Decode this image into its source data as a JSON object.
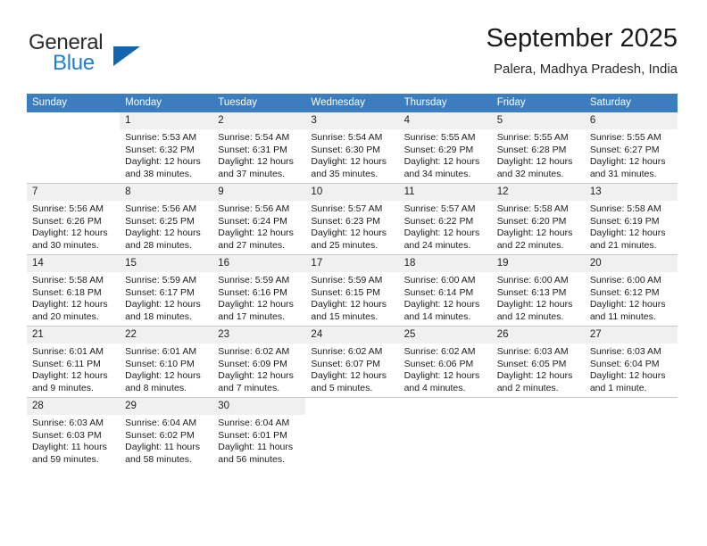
{
  "brand": {
    "word1": "General",
    "word2": "Blue",
    "triangle_color": "#1166ad",
    "blue_color": "#1f7fd0"
  },
  "header": {
    "title": "September 2025",
    "location": "Palera, Madhya Pradesh, India"
  },
  "calendar": {
    "header_bg": "#3b7dbf",
    "daynum_bg": "#f0f0f0",
    "weekdays": [
      "Sunday",
      "Monday",
      "Tuesday",
      "Wednesday",
      "Thursday",
      "Friday",
      "Saturday"
    ],
    "weeks": [
      [
        {
          "day": "",
          "blank": true,
          "lines": []
        },
        {
          "day": "1",
          "lines": [
            "Sunrise: 5:53 AM",
            "Sunset: 6:32 PM",
            "Daylight: 12 hours",
            "and 38 minutes."
          ]
        },
        {
          "day": "2",
          "lines": [
            "Sunrise: 5:54 AM",
            "Sunset: 6:31 PM",
            "Daylight: 12 hours",
            "and 37 minutes."
          ]
        },
        {
          "day": "3",
          "lines": [
            "Sunrise: 5:54 AM",
            "Sunset: 6:30 PM",
            "Daylight: 12 hours",
            "and 35 minutes."
          ]
        },
        {
          "day": "4",
          "lines": [
            "Sunrise: 5:55 AM",
            "Sunset: 6:29 PM",
            "Daylight: 12 hours",
            "and 34 minutes."
          ]
        },
        {
          "day": "5",
          "lines": [
            "Sunrise: 5:55 AM",
            "Sunset: 6:28 PM",
            "Daylight: 12 hours",
            "and 32 minutes."
          ]
        },
        {
          "day": "6",
          "lines": [
            "Sunrise: 5:55 AM",
            "Sunset: 6:27 PM",
            "Daylight: 12 hours",
            "and 31 minutes."
          ]
        }
      ],
      [
        {
          "day": "7",
          "lines": [
            "Sunrise: 5:56 AM",
            "Sunset: 6:26 PM",
            "Daylight: 12 hours",
            "and 30 minutes."
          ]
        },
        {
          "day": "8",
          "lines": [
            "Sunrise: 5:56 AM",
            "Sunset: 6:25 PM",
            "Daylight: 12 hours",
            "and 28 minutes."
          ]
        },
        {
          "day": "9",
          "lines": [
            "Sunrise: 5:56 AM",
            "Sunset: 6:24 PM",
            "Daylight: 12 hours",
            "and 27 minutes."
          ]
        },
        {
          "day": "10",
          "lines": [
            "Sunrise: 5:57 AM",
            "Sunset: 6:23 PM",
            "Daylight: 12 hours",
            "and 25 minutes."
          ]
        },
        {
          "day": "11",
          "lines": [
            "Sunrise: 5:57 AM",
            "Sunset: 6:22 PM",
            "Daylight: 12 hours",
            "and 24 minutes."
          ]
        },
        {
          "day": "12",
          "lines": [
            "Sunrise: 5:58 AM",
            "Sunset: 6:20 PM",
            "Daylight: 12 hours",
            "and 22 minutes."
          ]
        },
        {
          "day": "13",
          "lines": [
            "Sunrise: 5:58 AM",
            "Sunset: 6:19 PM",
            "Daylight: 12 hours",
            "and 21 minutes."
          ]
        }
      ],
      [
        {
          "day": "14",
          "lines": [
            "Sunrise: 5:58 AM",
            "Sunset: 6:18 PM",
            "Daylight: 12 hours",
            "and 20 minutes."
          ]
        },
        {
          "day": "15",
          "lines": [
            "Sunrise: 5:59 AM",
            "Sunset: 6:17 PM",
            "Daylight: 12 hours",
            "and 18 minutes."
          ]
        },
        {
          "day": "16",
          "lines": [
            "Sunrise: 5:59 AM",
            "Sunset: 6:16 PM",
            "Daylight: 12 hours",
            "and 17 minutes."
          ]
        },
        {
          "day": "17",
          "lines": [
            "Sunrise: 5:59 AM",
            "Sunset: 6:15 PM",
            "Daylight: 12 hours",
            "and 15 minutes."
          ]
        },
        {
          "day": "18",
          "lines": [
            "Sunrise: 6:00 AM",
            "Sunset: 6:14 PM",
            "Daylight: 12 hours",
            "and 14 minutes."
          ]
        },
        {
          "day": "19",
          "lines": [
            "Sunrise: 6:00 AM",
            "Sunset: 6:13 PM",
            "Daylight: 12 hours",
            "and 12 minutes."
          ]
        },
        {
          "day": "20",
          "lines": [
            "Sunrise: 6:00 AM",
            "Sunset: 6:12 PM",
            "Daylight: 12 hours",
            "and 11 minutes."
          ]
        }
      ],
      [
        {
          "day": "21",
          "lines": [
            "Sunrise: 6:01 AM",
            "Sunset: 6:11 PM",
            "Daylight: 12 hours",
            "and 9 minutes."
          ]
        },
        {
          "day": "22",
          "lines": [
            "Sunrise: 6:01 AM",
            "Sunset: 6:10 PM",
            "Daylight: 12 hours",
            "and 8 minutes."
          ]
        },
        {
          "day": "23",
          "lines": [
            "Sunrise: 6:02 AM",
            "Sunset: 6:09 PM",
            "Daylight: 12 hours",
            "and 7 minutes."
          ]
        },
        {
          "day": "24",
          "lines": [
            "Sunrise: 6:02 AM",
            "Sunset: 6:07 PM",
            "Daylight: 12 hours",
            "and 5 minutes."
          ]
        },
        {
          "day": "25",
          "lines": [
            "Sunrise: 6:02 AM",
            "Sunset: 6:06 PM",
            "Daylight: 12 hours",
            "and 4 minutes."
          ]
        },
        {
          "day": "26",
          "lines": [
            "Sunrise: 6:03 AM",
            "Sunset: 6:05 PM",
            "Daylight: 12 hours",
            "and 2 minutes."
          ]
        },
        {
          "day": "27",
          "lines": [
            "Sunrise: 6:03 AM",
            "Sunset: 6:04 PM",
            "Daylight: 12 hours",
            "and 1 minute."
          ]
        }
      ],
      [
        {
          "day": "28",
          "lines": [
            "Sunrise: 6:03 AM",
            "Sunset: 6:03 PM",
            "Daylight: 11 hours",
            "and 59 minutes."
          ]
        },
        {
          "day": "29",
          "lines": [
            "Sunrise: 6:04 AM",
            "Sunset: 6:02 PM",
            "Daylight: 11 hours",
            "and 58 minutes."
          ]
        },
        {
          "day": "30",
          "lines": [
            "Sunrise: 6:04 AM",
            "Sunset: 6:01 PM",
            "Daylight: 11 hours",
            "and 56 minutes."
          ]
        },
        {
          "day": "",
          "blank": true,
          "lines": []
        },
        {
          "day": "",
          "blank": true,
          "lines": []
        },
        {
          "day": "",
          "blank": true,
          "lines": []
        },
        {
          "day": "",
          "blank": true,
          "lines": []
        }
      ]
    ]
  }
}
